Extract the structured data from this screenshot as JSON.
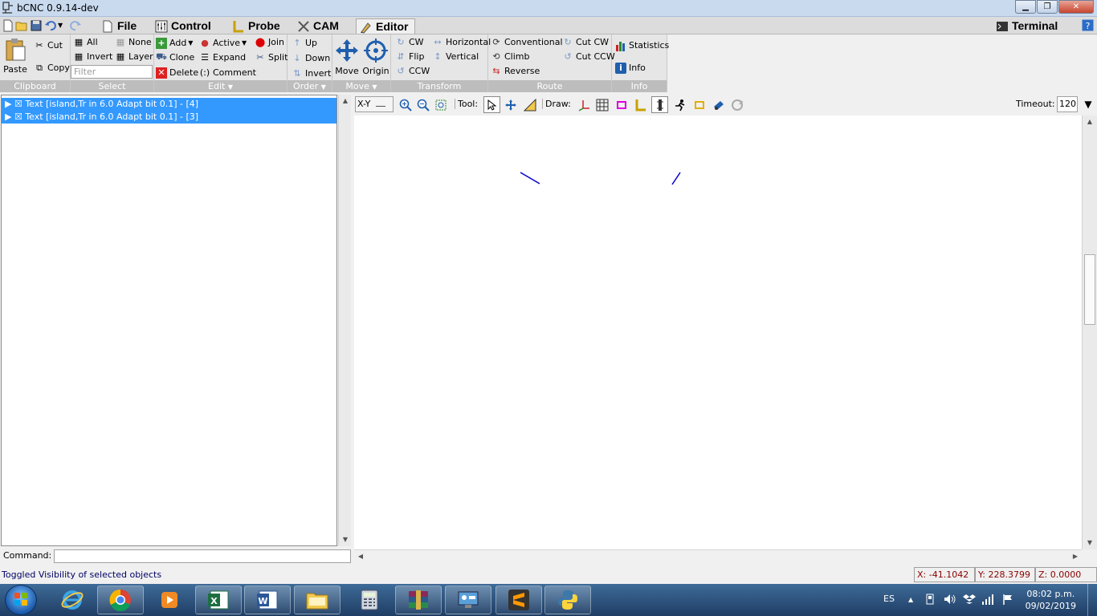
{
  "window": {
    "title": "bCNC 0.9.14-dev"
  },
  "menu": {
    "tabs": [
      {
        "label": "File"
      },
      {
        "label": "Control"
      },
      {
        "label": "Probe"
      },
      {
        "label": "CAM"
      },
      {
        "label": "Editor"
      }
    ],
    "terminal_label": "Terminal"
  },
  "ribbon": {
    "clipboard": {
      "label": "Clipboard",
      "paste": "Paste",
      "cut": "Cut",
      "copy": "Copy"
    },
    "select": {
      "label": "Select",
      "all": "All",
      "none": "None",
      "invert": "Invert",
      "layer": "Layer",
      "filter_placeholder": "Filter"
    },
    "edit": {
      "label": "Edit",
      "add": "Add",
      "active": "Active",
      "join": "Join",
      "clone": "Clone",
      "expand": "Expand",
      "split": "Split",
      "delete": "Delete",
      "comment": "Comment"
    },
    "order": {
      "label": "Order",
      "up": "Up",
      "down": "Down",
      "invert": "Invert"
    },
    "move": {
      "label": "Move",
      "move": "Move",
      "origin": "Origin"
    },
    "transform": {
      "label": "Transform",
      "cw": "CW",
      "horizontal": "Horizontal",
      "flip": "Flip",
      "vertical": "Vertical",
      "ccw": "CCW"
    },
    "route": {
      "label": "Route",
      "conventional": "Conventional",
      "cut_cw": "Cut CW",
      "climb": "Climb",
      "cut_ccw": "Cut CCW",
      "reverse": "Reverse"
    },
    "info": {
      "label": "Info",
      "statistics": "Statistics",
      "info": "Info"
    }
  },
  "tree": {
    "rows": [
      {
        "label": "▶ ☒ Text [island,Tr in 6.0 Adapt bit 0.1] - [4]"
      },
      {
        "label": "▶ ☒ Text [island,Tr in 6.0 Adapt bit 0.1] - [3]"
      }
    ]
  },
  "canvas_toolbar": {
    "view": "X-Y",
    "tool_label": "Tool:",
    "draw_label": "Draw:",
    "timeout_label": "Timeout:",
    "timeout_value": "120"
  },
  "command": {
    "label": "Command:",
    "value": ""
  },
  "status": {
    "message": "Toggled Visibility of selected objects",
    "x": "X: -41.1042",
    "y": "Y: 228.3799",
    "z": "Z: 0.0000"
  },
  "taskbar": {
    "lang": "ES",
    "time": "08:02 p.m.",
    "date": "09/02/2019"
  },
  "colors": {
    "selection": "#3399ff",
    "toolpath": "#0000cc",
    "coord_text": "#8a0000"
  }
}
